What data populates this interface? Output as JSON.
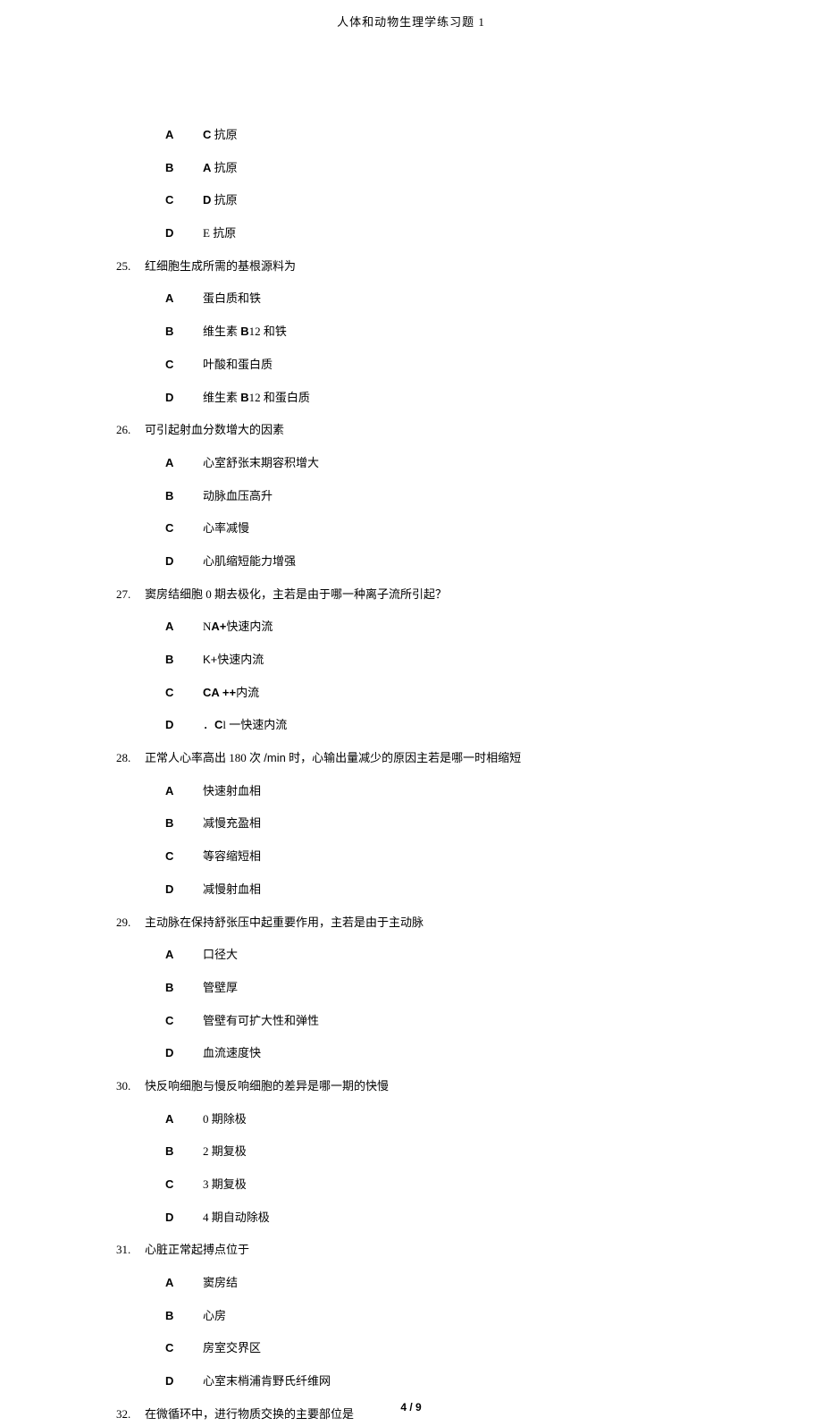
{
  "header": {
    "title": "人体和动物生理学练习题 1"
  },
  "orphan_options": [
    {
      "letter": "A",
      "text_bold": "C",
      "text_rest": " 抗原"
    },
    {
      "letter": "B",
      "text_bold": "A",
      "text_rest": " 抗原"
    },
    {
      "letter": "C",
      "text_bold": "D",
      "text_rest": " 抗原"
    },
    {
      "letter": "D",
      "text_plain": "E 抗原"
    }
  ],
  "questions": [
    {
      "num": "25.",
      "text": "红细胞生成所需的基根源料为",
      "options": [
        {
          "letter": "A",
          "text": "蛋白质和铁"
        },
        {
          "letter": "B",
          "html": "维生素 <span class='bold-latin'>B</span>12 和铁"
        },
        {
          "letter": "C",
          "text": "叶酸和蛋白质"
        },
        {
          "letter": "D",
          "html": "维生素 <span class='bold-latin'>B</span>12 和蛋白质"
        }
      ]
    },
    {
      "num": "26.",
      "text": "可引起射血分数增大的因素",
      "options": [
        {
          "letter": "A",
          "text": "心室舒张末期容积增大"
        },
        {
          "letter": "B",
          "text": "动脉血压高升"
        },
        {
          "letter": "C",
          "text": "心率减慢"
        },
        {
          "letter": "D",
          "text": "心肌缩短能力增强"
        }
      ]
    },
    {
      "num": "27.",
      "text": "窦房结细胞 0 期去极化，主若是由于哪一种离子流所引起？",
      "options": [
        {
          "letter": "A",
          "html": "N<span class='bold-latin'>A+</span>快速内流"
        },
        {
          "letter": "B",
          "html": "<span class='latin'>K+</span>快速内流"
        },
        {
          "letter": "C",
          "html": "<span class='bold-latin'>CA ++</span>内流"
        },
        {
          "letter": "D",
          "html": " ．<span class='bold-latin'>C</span>l 一快速内流"
        }
      ]
    },
    {
      "num": "28.",
      "html": "正常人心率高出 180 次 <span class='latin'>/min</span> 时，心输出量减少的原因主若是哪一时相缩短",
      "options": [
        {
          "letter": "A",
          "text": "快速射血相"
        },
        {
          "letter": "B",
          "text": "减慢充盈相"
        },
        {
          "letter": "C",
          "text": "等容缩短相"
        },
        {
          "letter": "D",
          "text": "减慢射血相"
        }
      ]
    },
    {
      "num": "29.",
      "text": "主动脉在保持舒张压中起重要作用，主若是由于主动脉",
      "options": [
        {
          "letter": "A",
          "text": "口径大"
        },
        {
          "letter": "B",
          "text": "管壁厚"
        },
        {
          "letter": "C",
          "text": "管壁有可扩大性和弹性"
        },
        {
          "letter": "D",
          "text": "血流速度快"
        }
      ]
    },
    {
      "num": "30.",
      "text": "快反响细胞与慢反响细胞的差异是哪一期的快慢",
      "options": [
        {
          "letter": "A",
          "text": "0 期除极"
        },
        {
          "letter": "B",
          "text": "2 期复极"
        },
        {
          "letter": "C",
          "text": "3 期复极"
        },
        {
          "letter": "D",
          "text": "4 期自动除极"
        }
      ]
    },
    {
      "num": "31.",
      "text": "心脏正常起搏点位于",
      "options": [
        {
          "letter": "A",
          "text": "窦房结"
        },
        {
          "letter": "B",
          "text": "心房"
        },
        {
          "letter": "C",
          "text": "房室交界区"
        },
        {
          "letter": "D",
          "text": "心室末梢浦肯野氏纤维网"
        }
      ]
    },
    {
      "num": "32.",
      "text": "在微循环中，进行物质交换的主要部位是",
      "options": []
    }
  ],
  "footer": {
    "page": "4 / 9"
  }
}
